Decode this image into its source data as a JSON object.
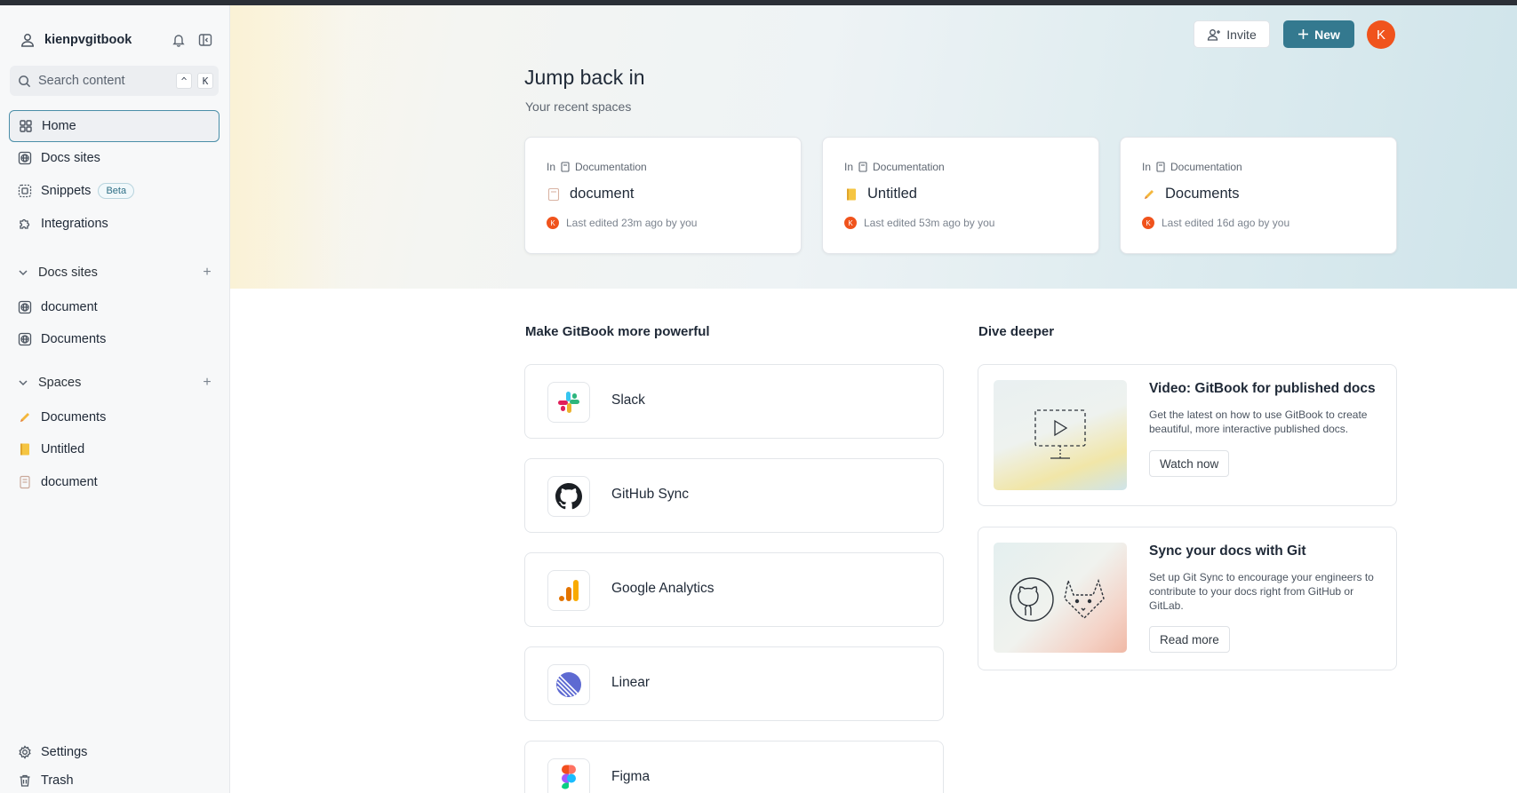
{
  "sidebar": {
    "org_name": "kienpvgitbook",
    "search": {
      "placeholder": "Search content",
      "shortcut_1": "^",
      "shortcut_2": "K"
    },
    "nav": [
      {
        "label": "Home",
        "icon": "grid-icon"
      },
      {
        "label": "Docs sites",
        "icon": "globe-icon"
      },
      {
        "label": "Snippets",
        "icon": "snippet-icon",
        "badge": "Beta"
      },
      {
        "label": "Integrations",
        "icon": "puzzle-icon"
      }
    ],
    "docs_sites": {
      "header": "Docs sites",
      "items": [
        {
          "label": "document"
        },
        {
          "label": "Documents"
        }
      ]
    },
    "spaces": {
      "header": "Spaces",
      "items": [
        {
          "label": "Documents"
        },
        {
          "label": "Untitled"
        },
        {
          "label": "document"
        }
      ]
    },
    "footer": [
      {
        "label": "Settings"
      },
      {
        "label": "Trash"
      }
    ]
  },
  "header": {
    "invite_label": "Invite",
    "new_label": "New",
    "avatar_initial": "K",
    "accent": "#34798f",
    "avatar_color": "#f0531c"
  },
  "jump_back": {
    "title": "Jump back in",
    "subtitle": "Your recent spaces",
    "cards": [
      {
        "in_label": "In",
        "collection": "Documentation",
        "title": "document",
        "avatar": "K",
        "meta": "Last edited 23m ago by you"
      },
      {
        "in_label": "In",
        "collection": "Documentation",
        "title": "Untitled",
        "avatar": "K",
        "meta": "Last edited 53m ago by you"
      },
      {
        "in_label": "In",
        "collection": "Documentation",
        "title": "Documents",
        "avatar": "K",
        "meta": "Last edited 16d ago by you"
      }
    ]
  },
  "integrations": {
    "title": "Make GitBook more powerful",
    "items": [
      {
        "name": "Slack"
      },
      {
        "name": "GitHub Sync"
      },
      {
        "name": "Google Analytics"
      },
      {
        "name": "Linear"
      },
      {
        "name": "Figma"
      }
    ]
  },
  "dive": {
    "title": "Dive deeper",
    "cards": [
      {
        "title": "Video: GitBook for published docs",
        "desc": "Get the latest on how to use GitBook to create beautiful, more interactive published docs.",
        "button": "Watch now"
      },
      {
        "title": "Sync your docs with Git",
        "desc": "Set up Git Sync to encourage your engineers to contribute to your docs right from GitHub or GitLab.",
        "button": "Read more"
      }
    ]
  }
}
